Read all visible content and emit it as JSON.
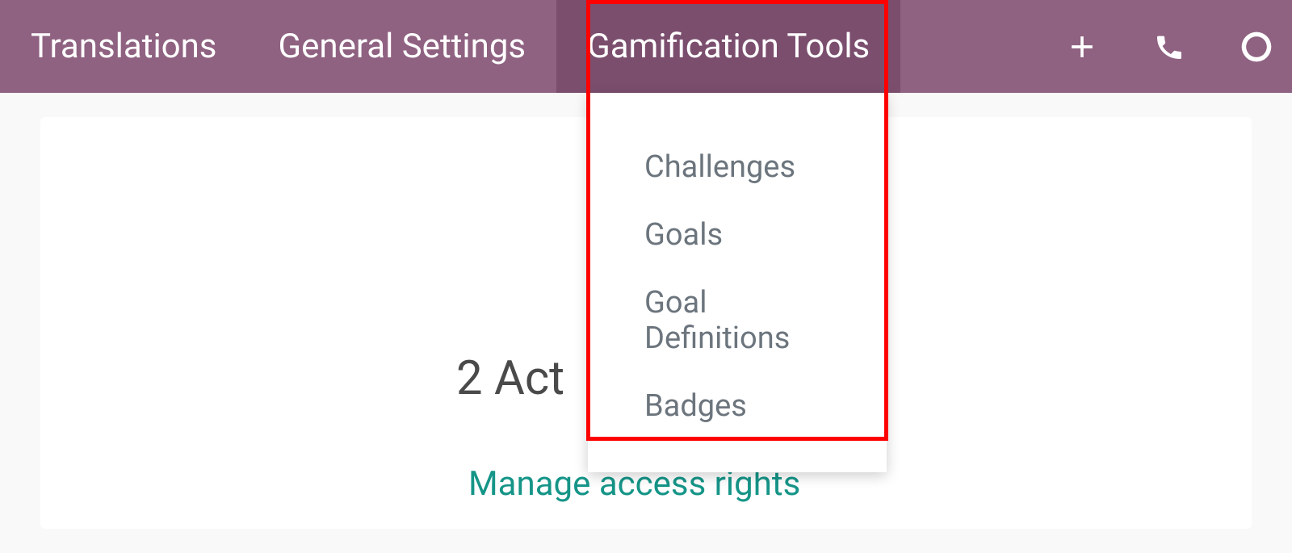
{
  "navbar": {
    "items": [
      {
        "label": "Translations"
      },
      {
        "label": "General Settings"
      },
      {
        "label": "Gamification Tools"
      }
    ]
  },
  "dropdown": {
    "items": [
      {
        "label": "Challenges"
      },
      {
        "label": "Goals"
      },
      {
        "label": "Goal Definitions"
      },
      {
        "label": "Badges"
      }
    ]
  },
  "content": {
    "main_text": "2 Act",
    "manage_link": "Manage access rights"
  }
}
